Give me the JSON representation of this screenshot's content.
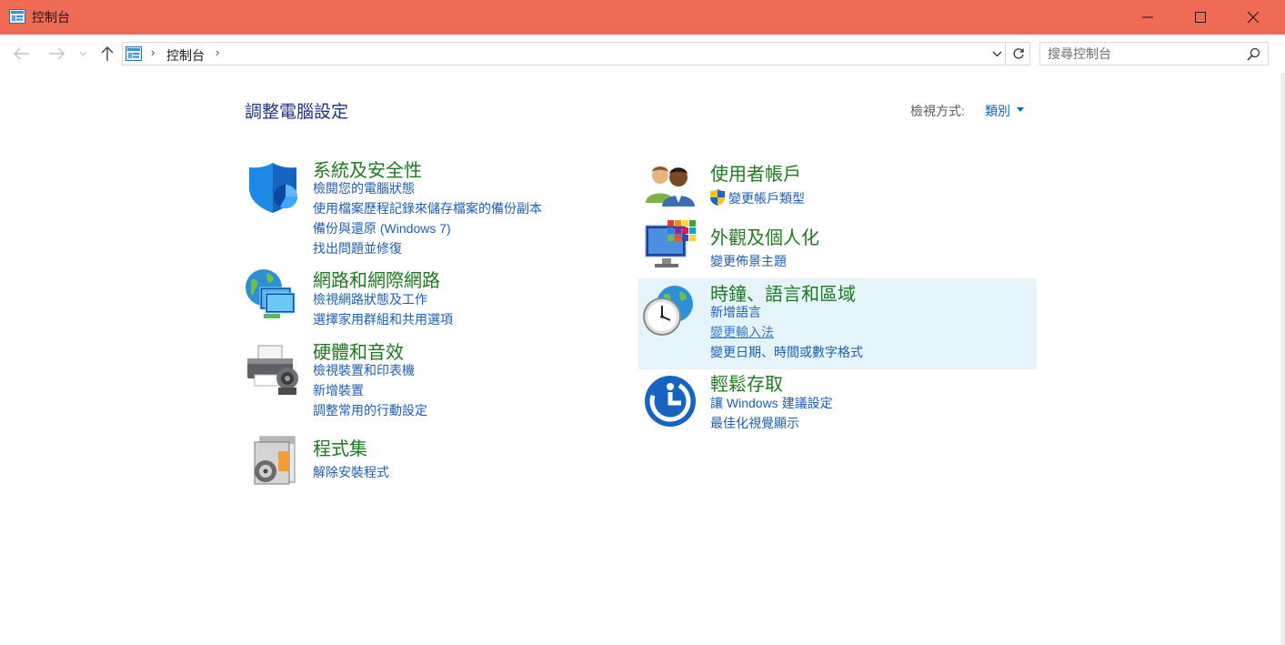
{
  "window": {
    "title": "控制台"
  },
  "addressbar": {
    "crumbs": [
      "控制台"
    ]
  },
  "search": {
    "placeholder": "搜尋控制台"
  },
  "main": {
    "title": "調整電腦設定",
    "view_by_label": "檢視方式:",
    "view_by_value": "類別"
  },
  "categories": [
    {
      "title": "系統及安全性",
      "icon": "shield-icon",
      "links": [
        "檢閱您的電腦狀態",
        "使用檔案歷程記錄來儲存檔案的備份副本",
        "備份與還原 (Windows 7)",
        "找出問題並修復"
      ]
    },
    {
      "title": "網路和網際網路",
      "icon": "network-globe-icon",
      "links": [
        "檢視網路狀態及工作",
        "選擇家用群組和共用選項"
      ]
    },
    {
      "title": "硬體和音效",
      "icon": "printer-icon",
      "links": [
        "檢視裝置和印表機",
        "新增裝置",
        "調整常用的行動設定"
      ]
    },
    {
      "title": "程式集",
      "icon": "programs-icon",
      "links": [
        "解除安裝程式"
      ]
    },
    {
      "title": "使用者帳戶",
      "icon": "users-icon",
      "links": [
        "變更帳戶類型"
      ]
    },
    {
      "title": "外觀及個人化",
      "icon": "appearance-monitor-icon",
      "links": [
        "變更佈景主題"
      ]
    },
    {
      "title": "時鐘、語言和區域",
      "icon": "clock-globe-icon",
      "links": [
        "新增語言",
        "變更輸入法",
        "變更日期、時間或數字格式"
      ]
    },
    {
      "title": "輕鬆存取",
      "icon": "ease-of-access-icon",
      "links": [
        "讓 Windows 建議設定",
        "最佳化視覺顯示"
      ]
    }
  ],
  "colors": {
    "titlebar": "#f06b54",
    "category_title": "#1e7a1e",
    "link": "#1a5fb4",
    "page_title": "#1e3287",
    "highlight": "#e5f3fb"
  }
}
